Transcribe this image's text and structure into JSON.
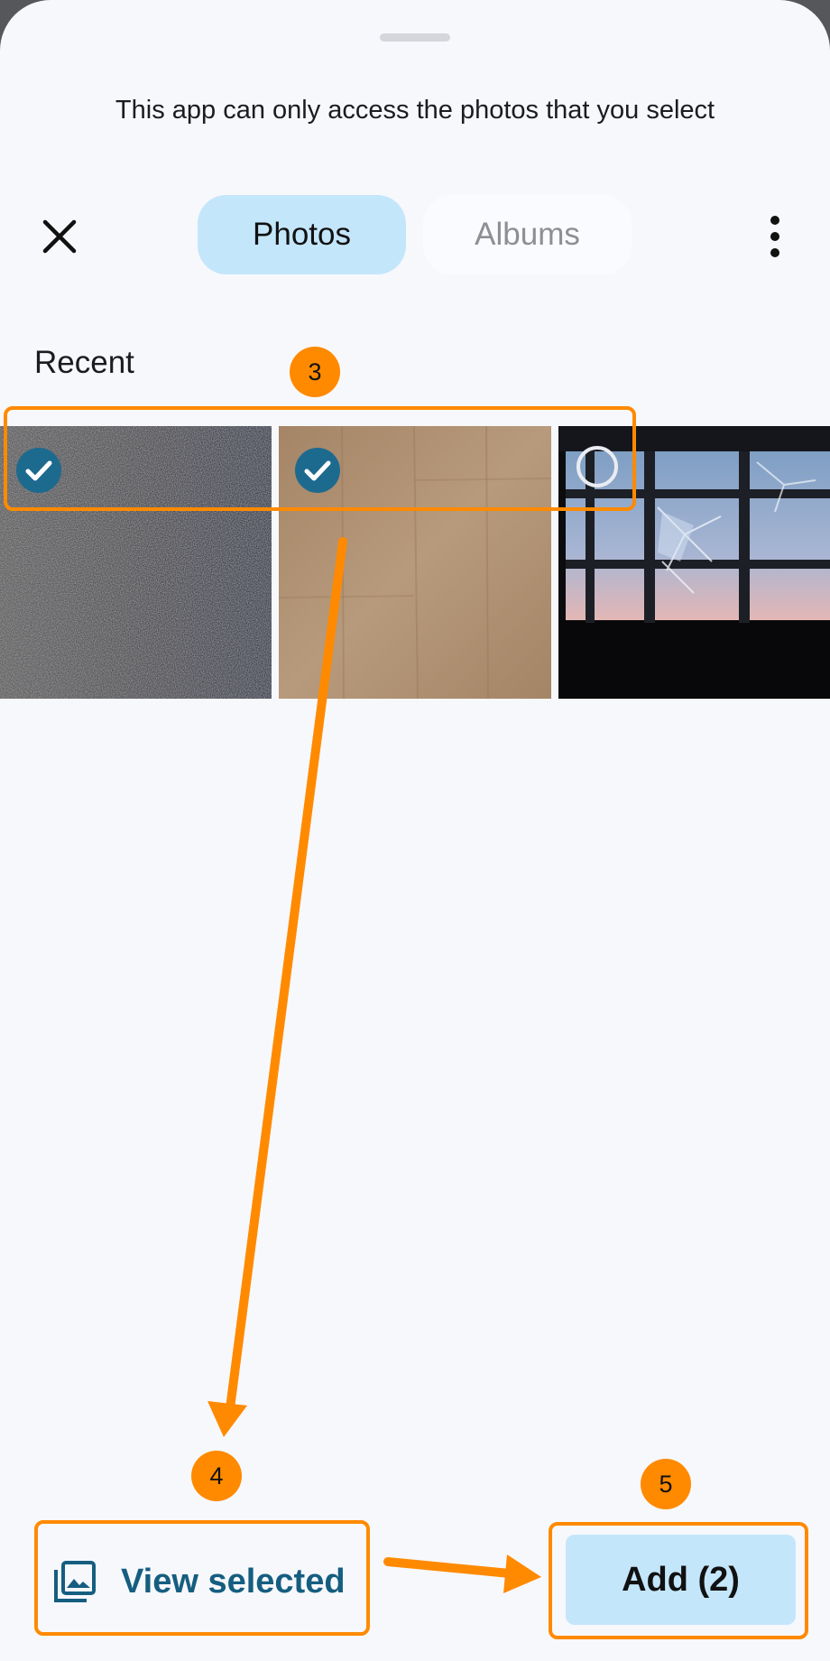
{
  "header": {
    "notice": "This app can only access the photos that you select"
  },
  "tabs": [
    {
      "label": "Photos",
      "selected": true
    },
    {
      "label": "Albums",
      "selected": false
    }
  ],
  "section": {
    "title": "Recent"
  },
  "photos": [
    {
      "description_icon": "carpet-photo",
      "selected": true
    },
    {
      "description_icon": "wood-floor-photo",
      "selected": true
    },
    {
      "description_icon": "broken-window-photo",
      "selected": false
    }
  ],
  "annotations": {
    "step3": "3",
    "step4": "4",
    "step5": "5"
  },
  "footer": {
    "view_selected_label": "View selected",
    "add_label": "Add (2)"
  },
  "colors": {
    "accent": "#c4e6fb",
    "check": "#1d6a8f",
    "callout": "#ff8a00"
  }
}
